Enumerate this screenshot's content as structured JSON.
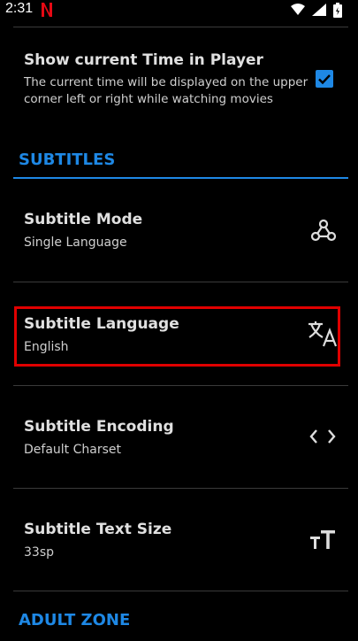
{
  "status_bar": {
    "time": "2:31"
  },
  "settings": {
    "show_time": {
      "title": "Show current Time in Player",
      "description_line1": "The current time will be displayed on the upper",
      "description_line2": "corner left or right while watching movies",
      "checked": true
    },
    "subtitles_section": {
      "header": "SUBTITLES",
      "items": [
        {
          "title": "Subtitle Mode",
          "summary": "Single Language",
          "icon": "webhook-icon"
        },
        {
          "title": "Subtitle Language",
          "summary": "English",
          "icon": "translate-icon"
        },
        {
          "title": "Subtitle Encoding",
          "summary": "Default Charset",
          "icon": "code-brackets-icon"
        },
        {
          "title": "Subtitle Text Size",
          "summary": "33sp",
          "icon": "text-size-icon"
        }
      ]
    },
    "adult_section": {
      "header": "ADULT ZONE"
    }
  },
  "colors": {
    "accent": "#1e88e5",
    "highlight_border": "#e00000",
    "background": "#000000"
  }
}
